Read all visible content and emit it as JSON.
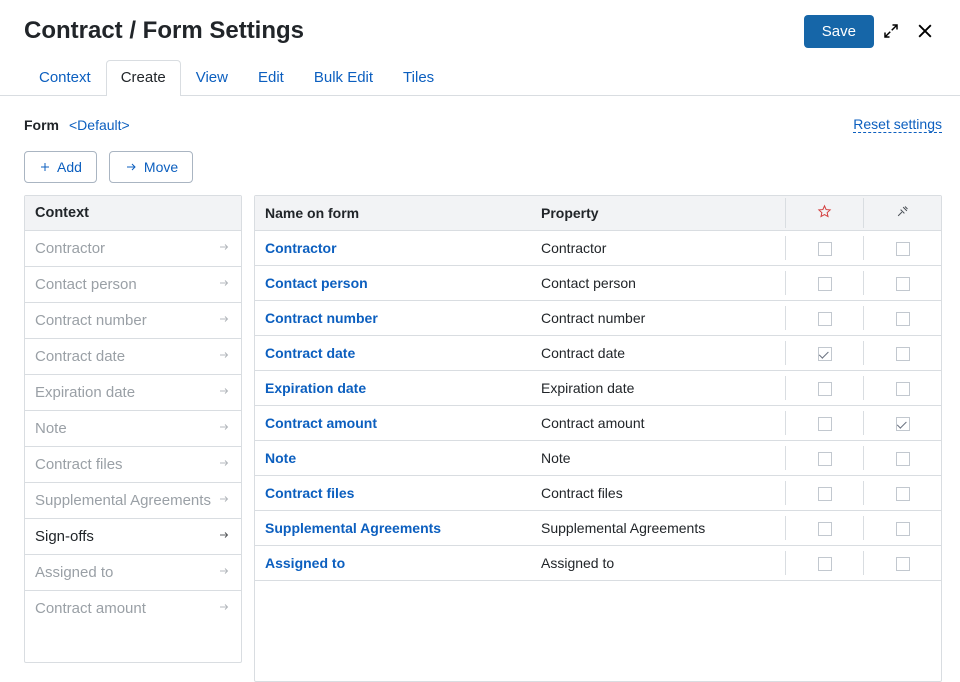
{
  "title": "Contract / Form Settings",
  "actions": {
    "save_label": "Save"
  },
  "tabs": [
    {
      "label": "Context",
      "active": false
    },
    {
      "label": "Create",
      "active": true
    },
    {
      "label": "View",
      "active": false
    },
    {
      "label": "Edit",
      "active": false
    },
    {
      "label": "Bulk Edit",
      "active": false
    },
    {
      "label": "Tiles",
      "active": false
    }
  ],
  "form_line": {
    "label": "Form",
    "default_label": "<Default>",
    "reset_label": "Reset settings"
  },
  "toolbar": {
    "add_label": "Add",
    "move_label": "Move"
  },
  "context_panel": {
    "header": "Context",
    "items": [
      {
        "label": "Contractor",
        "enabled": false
      },
      {
        "label": "Contact person",
        "enabled": false
      },
      {
        "label": "Contract number",
        "enabled": false
      },
      {
        "label": "Contract date",
        "enabled": false
      },
      {
        "label": "Expiration date",
        "enabled": false
      },
      {
        "label": "Note",
        "enabled": false
      },
      {
        "label": "Contract files",
        "enabled": false
      },
      {
        "label": "Supplemental Agreements",
        "enabled": false
      },
      {
        "label": "Sign-offs",
        "enabled": true
      },
      {
        "label": "Assigned to",
        "enabled": false
      },
      {
        "label": "Contract amount",
        "enabled": false
      }
    ]
  },
  "form_table": {
    "headers": {
      "name": "Name on form",
      "property": "Property",
      "icon_required": "star-icon",
      "icon_tool": "pin-icon"
    },
    "rows": [
      {
        "name": "Contractor",
        "property": "Contractor",
        "required": false,
        "tool": false
      },
      {
        "name": "Contact person",
        "property": "Contact person",
        "required": false,
        "tool": false
      },
      {
        "name": "Contract number",
        "property": "Contract number",
        "required": false,
        "tool": false
      },
      {
        "name": "Contract date",
        "property": "Contract date",
        "required": true,
        "tool": false
      },
      {
        "name": "Expiration date",
        "property": "Expiration date",
        "required": false,
        "tool": false
      },
      {
        "name": "Contract amount",
        "property": "Contract amount",
        "required": false,
        "tool": true
      },
      {
        "name": "Note",
        "property": "Note",
        "required": false,
        "tool": false
      },
      {
        "name": "Contract files",
        "property": "Contract files",
        "required": false,
        "tool": false
      },
      {
        "name": "Supplemental Agreements",
        "property": "Supplemental Agreements",
        "required": false,
        "tool": false
      },
      {
        "name": "Assigned to",
        "property": "Assigned to",
        "required": false,
        "tool": false
      }
    ]
  }
}
